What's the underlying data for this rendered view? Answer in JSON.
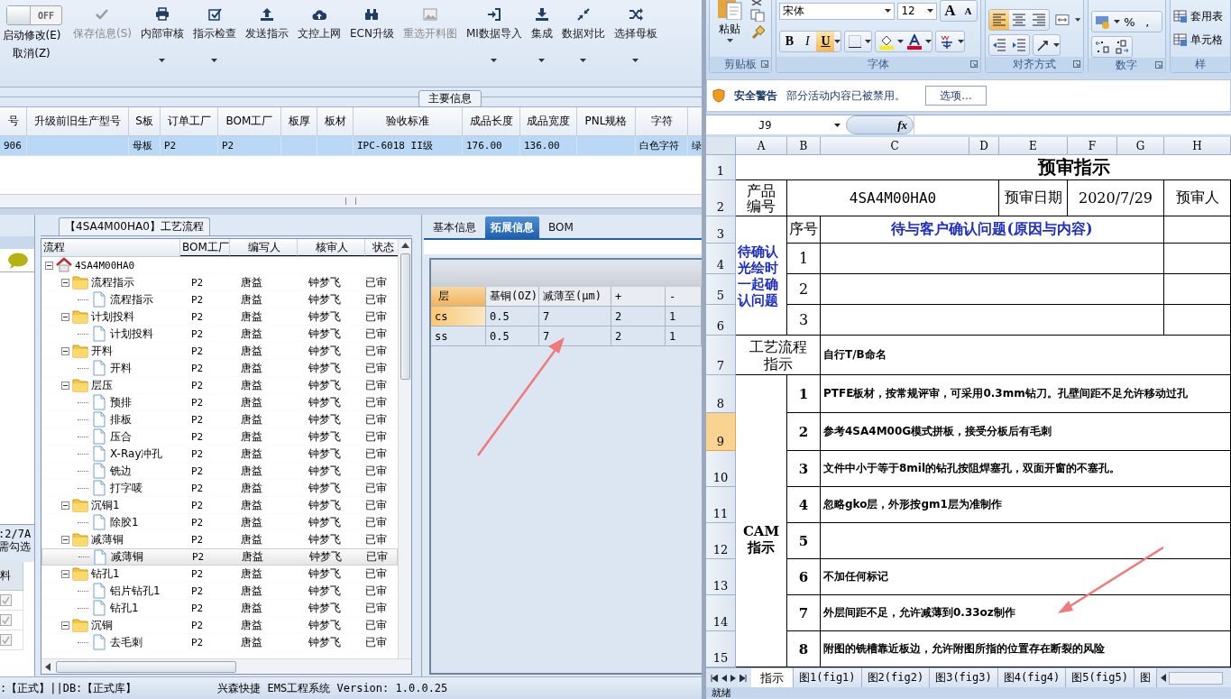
{
  "app": {
    "toolbar": {
      "edit_toggle": {
        "label": "OFF",
        "on": false
      },
      "toggle_actions": [
        "启动修改(E)",
        "取消(Z)"
      ],
      "buttons": [
        {
          "label": "保存信息(S)",
          "disabled": true,
          "dropdown": false
        },
        {
          "label": "内部审核",
          "disabled": false,
          "dropdown": true
        },
        {
          "label": "指示检查",
          "disabled": false,
          "dropdown": true
        },
        {
          "label": "发送指示",
          "disabled": false,
          "dropdown": false
        },
        {
          "label": "文控上网",
          "disabled": false,
          "dropdown": false
        },
        {
          "label": "ECN升级",
          "disabled": false,
          "dropdown": false
        },
        {
          "label": "重选开料图",
          "disabled": true,
          "dropdown": false
        },
        {
          "label": "MI数据导入",
          "disabled": false,
          "dropdown": true
        },
        {
          "label": "集成",
          "disabled": false,
          "dropdown": true
        },
        {
          "label": "数据对比",
          "disabled": false,
          "dropdown": true
        },
        {
          "label": "选择母板",
          "disabled": false,
          "dropdown": true
        }
      ]
    },
    "main_info": {
      "title": "主要信息",
      "columns": [
        "号",
        "升级前旧生产型号",
        "S板",
        "订单工厂",
        "BOM工厂",
        "板厚",
        "板材",
        "验收标准",
        "成品长度",
        "成品宽度",
        "PNL规格",
        "字符"
      ],
      "rows": [
        {
          "selected": true,
          "cells": [
            "906",
            null,
            "母板",
            "P2",
            "P2",
            null,
            null,
            "IPC-6018 II级",
            "176.00",
            "136.00",
            null,
            "白色字符",
            "绿"
          ]
        }
      ]
    },
    "left_panel": {
      "note_lines": [
        ":2/7A",
        "需勾选"
      ],
      "grid_column": "料",
      "rows": [
        {
          "checked": true
        },
        {
          "checked": true
        },
        {
          "checked": true
        }
      ]
    },
    "process": {
      "title": "【4SA4M00HA0】工艺流程",
      "columns": [
        "流程",
        "BOM工厂",
        "编写人",
        "核审人",
        "状态"
      ],
      "tree": [
        {
          "label": "4SA4M00HA0",
          "kind": "root",
          "expanded": true,
          "selected": false,
          "children": [
            {
              "label": "流程指示",
              "kind": "folder",
              "expanded": true,
              "selected": false,
              "bom": "P2",
              "writer": "唐益",
              "reviewer": "钟梦飞",
              "status": "已审",
              "children": [
                {
                  "label": "流程指示",
                  "kind": "file",
                  "selected": false,
                  "bom": "P2",
                  "writer": "唐益",
                  "reviewer": "钟梦飞",
                  "status": "已审"
                }
              ]
            },
            {
              "label": "计划投料",
              "kind": "folder",
              "expanded": true,
              "selected": false,
              "bom": "P2",
              "writer": "唐益",
              "reviewer": "钟梦飞",
              "status": "已审",
              "children": [
                {
                  "label": "计划投料",
                  "kind": "file",
                  "selected": false,
                  "bom": "P2",
                  "writer": "唐益",
                  "reviewer": "钟梦飞",
                  "status": "已审"
                }
              ]
            },
            {
              "label": "开料",
              "kind": "folder",
              "expanded": true,
              "selected": false,
              "bom": "P2",
              "writer": "唐益",
              "reviewer": "钟梦飞",
              "status": "已审",
              "children": [
                {
                  "label": "开料",
                  "kind": "file",
                  "selected": false,
                  "bom": "P2",
                  "writer": "唐益",
                  "reviewer": "钟梦飞",
                  "status": "已审"
                }
              ]
            },
            {
              "label": "层压",
              "kind": "folder",
              "expanded": true,
              "selected": false,
              "bom": "P2",
              "writer": "唐益",
              "reviewer": "钟梦飞",
              "status": "已审",
              "children": [
                {
                  "label": "预排",
                  "kind": "file",
                  "selected": false,
                  "bom": "P2",
                  "writer": "唐益",
                  "reviewer": "钟梦飞",
                  "status": "已审"
                },
                {
                  "label": "排板",
                  "kind": "file",
                  "selected": false,
                  "bom": "P2",
                  "writer": "唐益",
                  "reviewer": "钟梦飞",
                  "status": "已审"
                },
                {
                  "label": "压合",
                  "kind": "file",
                  "selected": false,
                  "bom": "P2",
                  "writer": "唐益",
                  "reviewer": "钟梦飞",
                  "status": "已审"
                },
                {
                  "label": "X-Ray冲孔",
                  "kind": "file",
                  "selected": false,
                  "bom": "P2",
                  "writer": "唐益",
                  "reviewer": "钟梦飞",
                  "status": "已审"
                },
                {
                  "label": "铣边",
                  "kind": "file",
                  "selected": false,
                  "bom": "P2",
                  "writer": "唐益",
                  "reviewer": "钟梦飞",
                  "status": "已审"
                },
                {
                  "label": "打字唛",
                  "kind": "file",
                  "selected": false,
                  "bom": "P2",
                  "writer": "唐益",
                  "reviewer": "钟梦飞",
                  "status": "已审"
                }
              ]
            },
            {
              "label": "沉铜1",
              "kind": "folder",
              "expanded": true,
              "selected": false,
              "bom": "P2",
              "writer": "唐益",
              "reviewer": "钟梦飞",
              "status": "已审",
              "children": [
                {
                  "label": "除胶1",
                  "kind": "file",
                  "selected": false,
                  "bom": "P2",
                  "writer": "唐益",
                  "reviewer": "钟梦飞",
                  "status": "已审"
                }
              ]
            },
            {
              "label": "减薄铜",
              "kind": "folder",
              "expanded": true,
              "selected": false,
              "bom": "P2",
              "writer": "唐益",
              "reviewer": "钟梦飞",
              "status": "已审",
              "children": [
                {
                  "label": "减薄铜",
                  "kind": "file",
                  "selected": true,
                  "bom": "P2",
                  "writer": "唐益",
                  "reviewer": "钟梦飞",
                  "status": "已审"
                }
              ]
            },
            {
              "label": "钻孔1",
              "kind": "folder",
              "expanded": true,
              "selected": false,
              "bom": "P2",
              "writer": "唐益",
              "reviewer": "钟梦飞",
              "status": "已审",
              "children": [
                {
                  "label": "铝片钻孔1",
                  "kind": "file",
                  "selected": false,
                  "bom": "P2",
                  "writer": "唐益",
                  "reviewer": "钟梦飞",
                  "status": "已审"
                },
                {
                  "label": "钻孔1",
                  "kind": "file",
                  "selected": false,
                  "bom": "P2",
                  "writer": "唐益",
                  "reviewer": "钟梦飞",
                  "status": "已审"
                }
              ]
            },
            {
              "label": "沉铜",
              "kind": "folder",
              "expanded": true,
              "selected": false,
              "bom": "P2",
              "writer": "唐益",
              "reviewer": "钟梦飞",
              "status": "已审",
              "children": [
                {
                  "label": "去毛刺",
                  "kind": "file",
                  "selected": false,
                  "bom": "P2",
                  "writer": "唐益",
                  "reviewer": "钟梦飞",
                  "status": "已审"
                }
              ]
            }
          ]
        }
      ]
    },
    "detail": {
      "tabs": [
        {
          "label": "基本信息",
          "selected": false
        },
        {
          "label": "拓展信息",
          "selected": true
        },
        {
          "label": "BOM",
          "selected": false
        }
      ],
      "columns": [
        "层",
        "基铜(OZ)",
        "减薄至(μm)",
        "+",
        "-"
      ],
      "rows": [
        {
          "selected": true,
          "cells": [
            "cs",
            "0.5",
            "7",
            "2",
            "1"
          ]
        },
        {
          "selected": false,
          "cells": [
            "ss",
            "0.5",
            "7",
            "2",
            "1"
          ]
        }
      ]
    },
    "status_bar": {
      "environment": ":【正式】||DB:【正式库】",
      "product": "兴森快捷 EMS工程系统 Version: 1.0.0.25"
    }
  },
  "excel": {
    "ribbon": {
      "paste_label": "粘贴",
      "font_name": "宋体",
      "font_size": "12",
      "grow_font": "A",
      "shrink_font": "A",
      "bold": {
        "label": "B",
        "on": false
      },
      "italic": {
        "label": "I",
        "on": false
      },
      "underline": {
        "label": "U",
        "on": true
      },
      "alignment": [
        {
          "selected": true
        },
        {
          "selected": false
        },
        {
          "selected": false
        }
      ],
      "percent": "%",
      "comma": ",",
      "style_items": [
        "套用表",
        "单元格"
      ],
      "group_labels": [
        "剪贴板",
        "字体",
        "对齐方式",
        "数字",
        "样"
      ]
    },
    "security": {
      "title": "安全警告",
      "message": "部分活动内容已被禁用。",
      "button": "选项..."
    },
    "formula_bar": {
      "name_box": "J9",
      "function_label": "fx"
    },
    "columns": [
      "A",
      "B",
      "C",
      "D",
      "E",
      "F",
      "G",
      "H"
    ],
    "rows": [
      {
        "number": "1",
        "selected": false
      },
      {
        "number": "2",
        "selected": false
      },
      {
        "number": "3",
        "selected": false
      },
      {
        "number": "4",
        "selected": false
      },
      {
        "number": "5",
        "selected": false
      },
      {
        "number": "6",
        "selected": false
      },
      {
        "number": "7",
        "selected": false
      },
      {
        "number": "8",
        "selected": false
      },
      {
        "number": "9",
        "selected": true
      },
      {
        "number": "10",
        "selected": false
      },
      {
        "number": "11",
        "selected": false
      },
      {
        "number": "12",
        "selected": false
      },
      {
        "number": "13",
        "selected": false
      },
      {
        "number": "14",
        "selected": false
      },
      {
        "number": "15",
        "selected": false
      }
    ],
    "sheet": {
      "title": "预审指示",
      "product_label": "产品编号",
      "product_code": "4SA4M00HA0",
      "date_label": "预审日期",
      "date": "2020/7/29",
      "reviewer_label": "预审人",
      "confirm_section": {
        "label": "待确认光绘时一起确认问题",
        "number_header": "序号",
        "content_header": "待与客户确认问题(原因与内容)",
        "items": [
          {
            "number": "1"
          },
          {
            "number": "2"
          },
          {
            "number": "3"
          }
        ]
      },
      "process_section": {
        "label": "工艺流程指示",
        "text": "自行T/B命名"
      },
      "cam_section": {
        "label": "CAM指示",
        "items": [
          {
            "number": "1",
            "text": "PTFE板材，按常规评审，可采用0.3mm钻刀。孔壁间距不足允许移动过孔"
          },
          {
            "number": "2",
            "text": "参考4SA4M00G模式拼板，接受分板后有毛刺"
          },
          {
            "number": "3",
            "text": "文件中小于等于8mil的钻孔按阻焊塞孔，双面开窗的不塞孔。"
          },
          {
            "number": "4",
            "text": "忽略gko层，外形按gm1层为准制作"
          },
          {
            "number": "5"
          },
          {
            "number": "6",
            "text": "不加任何标记"
          },
          {
            "number": "7",
            "text": "外层间距不足，允许减薄到0.33oz制作"
          },
          {
            "number": "8",
            "text": "附图的铣槽靠近板边，允许附图所指的位置存在断裂的风险"
          }
        ]
      }
    },
    "sheet_tabs": [
      {
        "label": "指示",
        "selected": true
      },
      {
        "label": "图1(fig1)",
        "selected": false
      },
      {
        "label": "图2(fig2)",
        "selected": false
      },
      {
        "label": "图3(fig3)",
        "selected": false
      },
      {
        "label": "图4(fig4)",
        "selected": false
      },
      {
        "label": "图5(fig5)",
        "selected": false
      },
      {
        "label": "图",
        "selected": false
      }
    ],
    "status": "就绪"
  }
}
